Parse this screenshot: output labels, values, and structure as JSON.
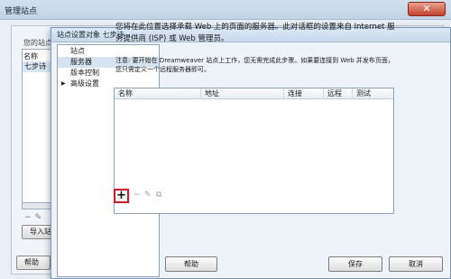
{
  "background_dialog": {
    "title": "管理站点",
    "site_list_label": "您的站点",
    "column_name": "名称",
    "site_row": "七步诗",
    "toolbar_icons": [
      "minus-icon",
      "edit-icon"
    ],
    "import_button": "导入站",
    "help_button": "帮助"
  },
  "dialog": {
    "title": "站点设置对象 七步诗",
    "nav": [
      {
        "label": "站点",
        "selected": false
      },
      {
        "label": "服务器",
        "selected": true
      },
      {
        "label": "版本控制",
        "selected": false
      },
      {
        "label": "高级设置",
        "selected": false,
        "expandable": true
      }
    ],
    "description": "您将在此位置选择承载 Web 上的页面的服务器。此对话框的设置来自 Internet 服务提供商 (ISP) 或 Web 管理员。",
    "note": "注意: 要开始在 Dreamweaver 站点上工作，您无需完成此步骤。如果要连接到 Web 并发布页面，您只需定义一个远程服务器即可。",
    "table": {
      "columns": [
        "名称",
        "地址",
        "连接",
        "远程",
        "测试"
      ],
      "rows": []
    },
    "toolbar": {
      "add": "+",
      "icons": [
        "minus-icon",
        "edit-icon",
        "duplicate-icon"
      ]
    },
    "buttons": {
      "help": "帮助",
      "save": "保存",
      "cancel": "取消"
    }
  }
}
